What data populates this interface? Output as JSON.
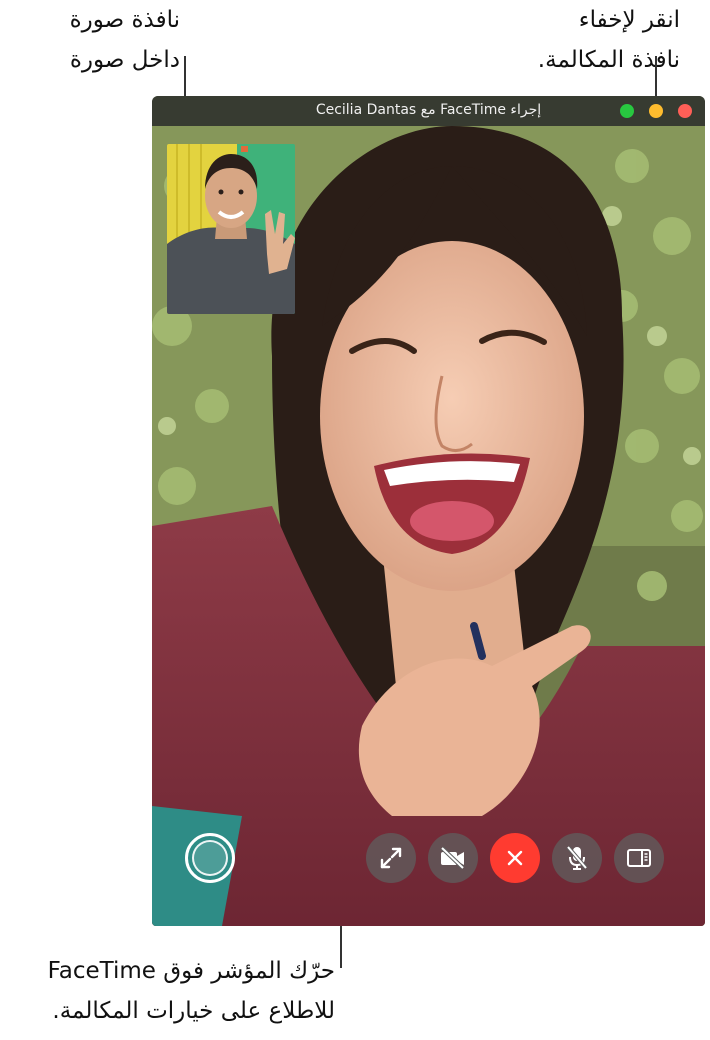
{
  "callouts": {
    "pip": {
      "line1": "نافذة صورة",
      "line2": "داخل صورة"
    },
    "hide": {
      "line1": "انقر لإخفاء",
      "line2": "نافذة المكالمة."
    },
    "controls": {
      "line1": "حرّك المؤشر فوق FaceTime",
      "line2": "للاطلاع على خيارات المكالمة."
    }
  },
  "window": {
    "title": "إجراء FaceTime مع Cecilia Dantas",
    "traffic_lights": {
      "close": "#ff5f57",
      "minimize": "#febc2e",
      "zoom": "#28c840"
    }
  },
  "controls": [
    {
      "name": "record-button",
      "icon": "record-circle-icon"
    },
    {
      "name": "fullscreen-button",
      "icon": "expand-arrows-icon"
    },
    {
      "name": "video-off-button",
      "icon": "camera-slash-icon"
    },
    {
      "name": "end-call-button",
      "icon": "x-icon",
      "color": "#ff3b30"
    },
    {
      "name": "mute-button",
      "icon": "mic-slash-icon"
    },
    {
      "name": "sidebar-button",
      "icon": "sidebar-icon"
    }
  ]
}
